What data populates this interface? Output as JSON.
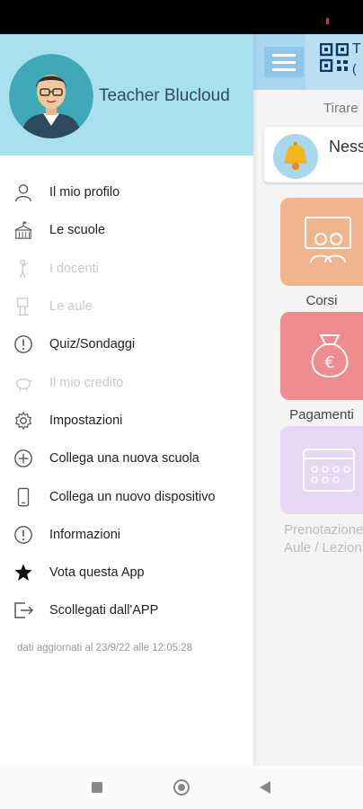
{
  "drawer": {
    "user_name": "Teacher Blucloud",
    "items": [
      {
        "label": "Il mio profilo",
        "icon": "person-icon",
        "enabled": true
      },
      {
        "label": "Le scuole",
        "icon": "school-icon",
        "enabled": true
      },
      {
        "label": "I docenti",
        "icon": "teacher-icon",
        "enabled": false
      },
      {
        "label": "Le aule",
        "icon": "classroom-icon",
        "enabled": false
      },
      {
        "label": "Quiz/Sondaggi",
        "icon": "info-circle-icon",
        "enabled": true
      },
      {
        "label": "Il mio credito",
        "icon": "piggy-bank-icon",
        "enabled": false
      },
      {
        "label": "Impostazioni",
        "icon": "gear-icon",
        "enabled": true
      },
      {
        "label": "Collega una nuova scuola",
        "icon": "plus-circle-icon",
        "enabled": true
      },
      {
        "label": "Collega un nuovo dispositivo",
        "icon": "phone-icon",
        "enabled": true
      },
      {
        "label": "Informazioni",
        "icon": "info-circle-icon",
        "enabled": true
      },
      {
        "label": "Vota questa App",
        "icon": "star-icon",
        "enabled": true
      },
      {
        "label": "Scollegati dall'APP",
        "icon": "logout-icon",
        "enabled": true
      }
    ],
    "updated_text": "dati aggiornati al 23/9/22 alle 12:05:28"
  },
  "background": {
    "title": "T",
    "title_sub": "(",
    "hint": "Tirare",
    "notification": "Ness",
    "tiles": [
      {
        "label": "Corsi",
        "color": "#f0b48f"
      },
      {
        "label": "Pagamenti",
        "color": "#f08b8e"
      },
      {
        "label_line1": "Prenotazione",
        "label_line2": "Aule / Lezioni",
        "color": "#e6d7f2"
      }
    ]
  },
  "colors": {
    "drawer_header": "#a9e0ee",
    "toolbar": "#a9d7f0",
    "accent": "#8ec7ea"
  }
}
